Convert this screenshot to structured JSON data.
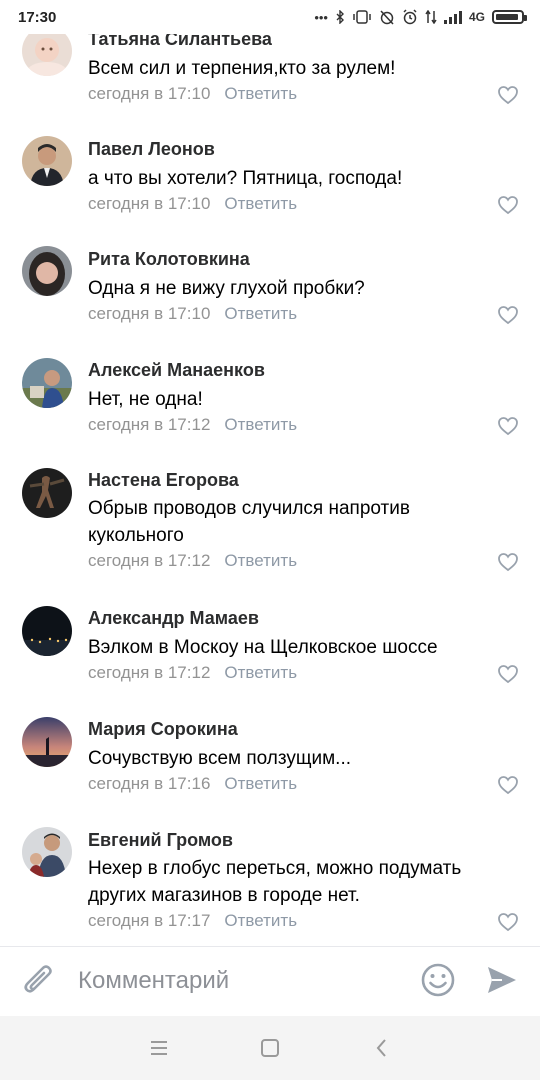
{
  "status_bar": {
    "time": "17:30",
    "network": "4G",
    "icons": [
      "more-dots-icon",
      "bluetooth-icon",
      "vibrate-icon",
      "alarm-off-icon",
      "alarm-icon",
      "data-arrows-icon",
      "signal-icon",
      "battery-icon"
    ]
  },
  "comments": [
    {
      "author": "Татьяна Силантьева",
      "text": "Всем сил и терпения,кто за рулем!",
      "time": "сегодня в 17:10",
      "reply": "Ответить",
      "avatar": "avatar-baby"
    },
    {
      "author": "Павел Леонов",
      "text": "а что вы хотели? Пятница, господа!",
      "time": "сегодня в 17:10",
      "reply": "Ответить",
      "avatar": "avatar-man-suit"
    },
    {
      "author": "Рита Колотовкина",
      "text": "Одна я не вижу глухой пробки?",
      "time": "сегодня в 17:10",
      "reply": "Ответить",
      "avatar": "avatar-woman"
    },
    {
      "author": "Алексей Манаенков",
      "text": "Нет, не одна!",
      "time": "сегодня в 17:12",
      "reply": "Ответить",
      "avatar": "avatar-outdoor"
    },
    {
      "author": "Настена Егорова",
      "text": "Обрыв проводов случился напротив кукольного",
      "time": "сегодня в 17:12",
      "reply": "Ответить",
      "avatar": "avatar-dark-figure"
    },
    {
      "author": "Александр Мамаев",
      "text": "Вэлком в Москоу на Щелковское  шоссе",
      "time": "сегодня в 17:12",
      "reply": "Ответить",
      "avatar": "avatar-night-city"
    },
    {
      "author": "Мария Сорокина",
      "text": "Сочувствую всем ползущим...",
      "time": "сегодня в 17:16",
      "reply": "Ответить",
      "avatar": "avatar-sunset"
    },
    {
      "author": "Евгений Громов",
      "text": "Нехер в глобус переться, можно подумать других магазинов в городе нет.",
      "time": "сегодня в 17:17",
      "reply": "Ответить",
      "avatar": "avatar-man-child"
    }
  ],
  "composer": {
    "placeholder": "Комментарий",
    "attach_icon": "paperclip-icon",
    "emoji_icon": "smiley-icon",
    "send_icon": "send-icon"
  },
  "nav": {
    "menu_icon": "menu-icon",
    "home_icon": "home-square-icon",
    "back_icon": "back-chevron-icon"
  }
}
